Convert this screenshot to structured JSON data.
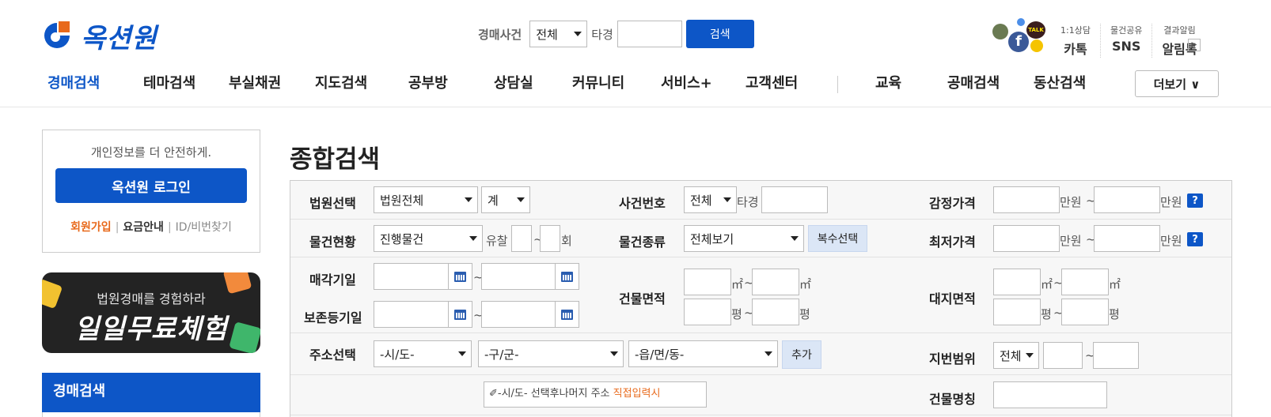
{
  "brand": {
    "name": "옥션원",
    "colors": {
      "primary": "#0d56c7",
      "accent": "#e8691b"
    }
  },
  "header_search": {
    "label": "경매사건",
    "court_select": "전체",
    "prefix": "타경",
    "case_input": "",
    "button": "검색"
  },
  "header_links": [
    {
      "small": "1:1상담",
      "big": "카톡"
    },
    {
      "small": "물건공유",
      "big": "SNS"
    },
    {
      "small": "결과알림",
      "big": "알림톡"
    }
  ],
  "nav": {
    "items": [
      "경매검색",
      "테마검색",
      "부실채권",
      "지도검색",
      "공부방",
      "상담실",
      "커뮤니티",
      "서비스+",
      "고객센터",
      "교육",
      "공매검색",
      "동산검색"
    ],
    "more": "더보기 ∨"
  },
  "login": {
    "message": "개인정보를 더 안전하게.",
    "button": "옥션원 로그인",
    "signup": "회원가입",
    "sep": "|",
    "pricing": "요금안내",
    "find": "ID/비번찾기"
  },
  "banner": {
    "line1": "법원경매를 경험하라",
    "line2": "일일무료체험"
  },
  "sidebar": {
    "section": "경매검색"
  },
  "page_title": "종합검색",
  "form": {
    "court": {
      "label": "법원선택",
      "value": "법원전체",
      "sub": "계"
    },
    "case_no": {
      "label": "사건번호",
      "select": "전체",
      "prefix": "타경"
    },
    "appraisal": {
      "label": "감정가격",
      "unit": "만원",
      "tilde": "~"
    },
    "status": {
      "label": "물건현황",
      "value": "진행물건",
      "fail_label": "유찰",
      "tilde": "~",
      "suffix": "회"
    },
    "type": {
      "label": "물건종류",
      "value": "전체보기",
      "multi": "복수선택"
    },
    "min_price": {
      "label": "최저가격",
      "unit": "만원",
      "tilde": "~"
    },
    "sale_date": {
      "label": "매각기일",
      "tilde": "~"
    },
    "reg_date": {
      "label": "보존등기일",
      "tilde": "~"
    },
    "building_area": {
      "label": "건물면적",
      "unit_m": "㎡",
      "unit_p": "평",
      "tilde": "~"
    },
    "land_area": {
      "label": "대지면적",
      "unit_m": "㎡",
      "unit_p": "평",
      "tilde": "~"
    },
    "address": {
      "label": "주소선택",
      "sido": "-시/도-",
      "gugun": "-구/군-",
      "dong": "-읍/면/동-",
      "add": "추가"
    },
    "lot_range": {
      "label": "지번범위",
      "value": "전체",
      "tilde": "~"
    },
    "hint": {
      "text": "✐-시/도- 선택후나머지 주소 ",
      "highlight": "직접입력시"
    },
    "building_name": {
      "label": "건물명칭"
    }
  }
}
